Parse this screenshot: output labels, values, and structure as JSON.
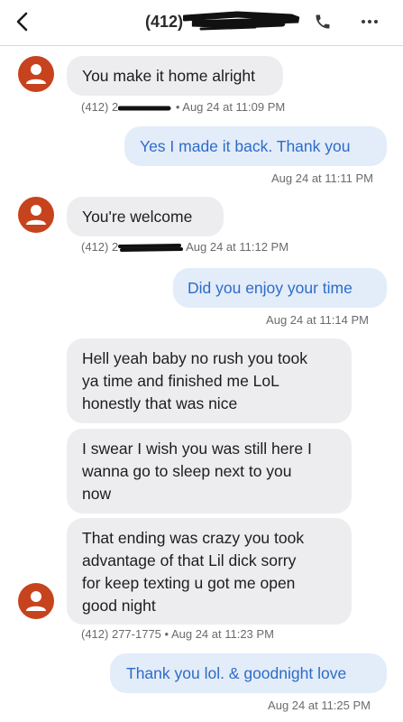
{
  "header": {
    "title": "(412)",
    "back_icon": "chevron-left-icon",
    "call_icon": "phone-icon",
    "more_icon": "more-horizontal-icon"
  },
  "messages": [
    {
      "direction": "incoming",
      "text": "You make it home alright",
      "meta_prefix": "(412) 2",
      "meta_suffix": "• Aug 24 at 11:09 PM"
    },
    {
      "direction": "outgoing",
      "text": "Yes I made it back. Thank you",
      "meta": "Aug 24 at 11:11 PM"
    },
    {
      "direction": "incoming",
      "text": "You're welcome",
      "meta_prefix": "(412) 2",
      "meta_suffix": "Aug 24 at 11:12 PM"
    },
    {
      "direction": "outgoing",
      "text": "Did you enjoy your time",
      "meta": "Aug 24 at 11:14 PM"
    },
    {
      "direction": "incoming",
      "text": "Hell yeah baby no rush you took\nya time and finished me LoL\nhonestly that was nice"
    },
    {
      "direction": "incoming",
      "text": "I swear I wish you was still here I\nwanna go to sleep next to you\nnow"
    },
    {
      "direction": "incoming",
      "text": "That ending was crazy you took\nadvantage of that Lil dick sorry\nfor keep texting u got me open\ngood night",
      "meta": "(412) 277-1775 • Aug 24 at 11:23 PM"
    },
    {
      "direction": "outgoing",
      "text": "Thank you lol. & goodnight love",
      "meta": "Aug 24 at 11:25 PM"
    }
  ],
  "colors": {
    "avatar": "#c6431d",
    "incoming_bubble": "#ededf0",
    "outgoing_bubble": "#e3ecf9",
    "outgoing_text": "#2d6cc8"
  }
}
